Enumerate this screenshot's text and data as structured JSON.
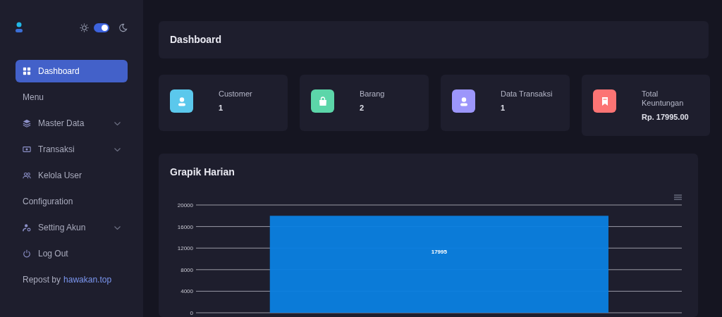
{
  "theme_toggle": {
    "on": true
  },
  "sidebar": {
    "items": [
      {
        "kind": "link",
        "label": "Dashboard",
        "selected": true,
        "has_submenu": false
      },
      {
        "kind": "heading",
        "label": "Menu"
      },
      {
        "kind": "link",
        "label": "Master Data",
        "selected": false,
        "has_submenu": true
      },
      {
        "kind": "link",
        "label": "Transaksi",
        "selected": false,
        "has_submenu": true
      },
      {
        "kind": "link",
        "label": "Kelola User",
        "selected": false,
        "has_submenu": false
      },
      {
        "kind": "heading",
        "label": "Configuration"
      },
      {
        "kind": "link",
        "label": "Setting Akun",
        "selected": false,
        "has_submenu": true
      },
      {
        "kind": "link",
        "label": "Log Out",
        "selected": false,
        "has_submenu": false
      },
      {
        "kind": "credit",
        "label": "Repost by",
        "link": "hawakan.top"
      }
    ]
  },
  "page_title": "Dashboard",
  "stats": [
    {
      "label": "Customer",
      "value": "1",
      "color": "#5bc8ec"
    },
    {
      "label": "Barang",
      "value": "2",
      "color": "#5cd6a9"
    },
    {
      "label": "Data Transaksi",
      "value": "1",
      "color": "#9c96fb"
    },
    {
      "label": "Total Keuntungan",
      "value": "Rp. 17995.00",
      "color": "#fc7474"
    }
  ],
  "chart": {
    "title": "Grapik Harian",
    "chart_data": {
      "type": "bar",
      "values": [
        17995
      ],
      "ylim": [
        0,
        20000
      ],
      "yticks": [
        0,
        4000,
        8000,
        12000,
        16000,
        20000
      ],
      "data_labels": true,
      "grid": true
    }
  }
}
